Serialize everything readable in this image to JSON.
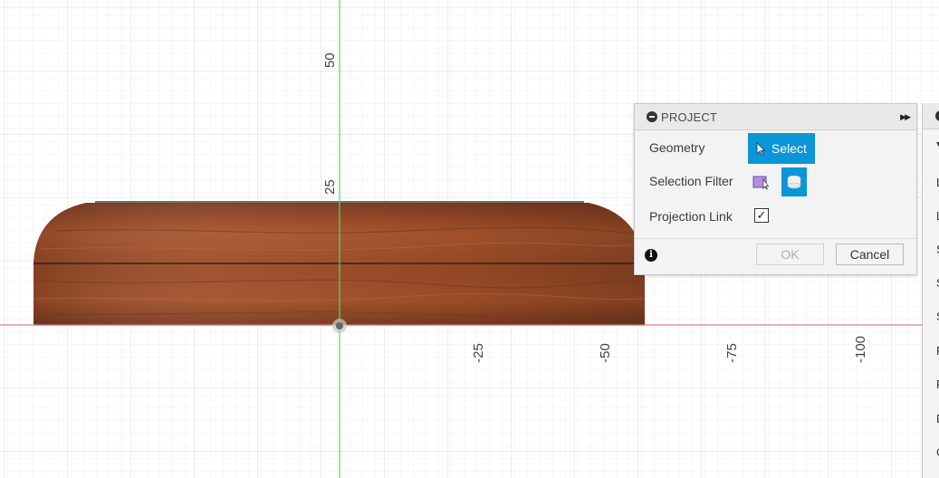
{
  "viewport": {
    "axis_labels": {
      "y_50": "50",
      "y_25": "25",
      "x_neg25": "-25",
      "x_neg50": "-50",
      "x_neg75": "-75",
      "x_neg100": "-100"
    }
  },
  "project_dialog": {
    "title": "PROJECT",
    "geometry_label": "Geometry",
    "select_label": "Select",
    "selection_filter_label": "Selection Filter",
    "projection_link_label": "Projection Link",
    "projection_link_checked": "✓",
    "ok_label": "OK",
    "cancel_label": "Cancel",
    "info_glyph": "i",
    "expand_glyph": "▶▶"
  },
  "side_panel": {
    "collapse_glyph": "▾",
    "items": [
      "L",
      "L",
      "S",
      "S",
      "S",
      "F",
      "F",
      "D",
      "C"
    ]
  },
  "colors": {
    "select_blue": "#0a96d8",
    "y_axis": "#5fd25f",
    "x_axis": "#e88a8a",
    "wood": "#9a4a28"
  }
}
